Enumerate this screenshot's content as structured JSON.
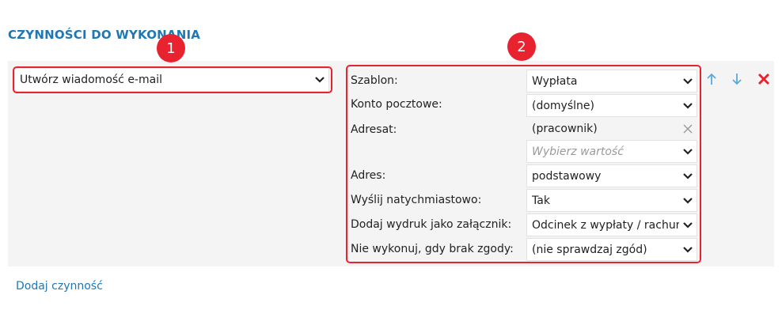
{
  "section": {
    "title": "CZYNNOŚCI DO WYKONANIA"
  },
  "action": {
    "selected": "Utwórz wiadomość e-mail"
  },
  "badges": {
    "first": "1",
    "second": "2"
  },
  "fields": [
    {
      "label": "Szablon:",
      "value": "Wypłata"
    },
    {
      "label": "Konto pocztowe:",
      "value": "(domyślne)"
    },
    {
      "label": "Adresat:",
      "value": "(pracownik)",
      "placeholder": "Wybierz wartość"
    },
    {
      "label": "Adres:",
      "value": "podstawowy"
    },
    {
      "label": "Wyślij natychmiastowo:",
      "value": "Tak"
    },
    {
      "label": "Dodaj wydruk jako załącznik:",
      "value": "Odcinek z wypłaty / rachun"
    },
    {
      "label": "Nie wykonuj, gdy brak zgody:",
      "value": "(nie sprawdzaj zgód)"
    }
  ],
  "footer": {
    "add_action_link": "Dodaj czynność"
  },
  "colors": {
    "accent": "#1f77b4",
    "highlight": "#e8232f",
    "arrow": "#5aa9dd",
    "delete": "#e8232f"
  },
  "icons": [
    "chevron-down-icon",
    "clear-icon",
    "arrow-up-icon",
    "arrow-down-icon",
    "delete-icon"
  ]
}
